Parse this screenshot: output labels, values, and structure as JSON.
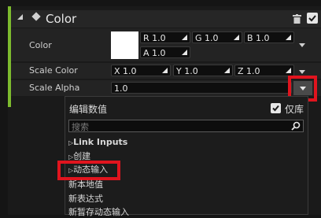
{
  "section": {
    "title": "Color"
  },
  "rows": {
    "color": {
      "label": "Color",
      "r": "R 1.0",
      "g": "G 1.0",
      "b": "B 1.0",
      "a": "A 1.0"
    },
    "scale_color": {
      "label": "Scale Color",
      "x": "X 1.0",
      "y": "Y 1.0",
      "z": "Z 1.0"
    },
    "scale_alpha": {
      "label": "Scale Alpha",
      "value": "1.0"
    }
  },
  "menu": {
    "title": "编辑数值",
    "library_label": "仅库",
    "search_placeholder": "搜索",
    "items": [
      {
        "label": "Link Inputs",
        "expander": "▷"
      },
      {
        "label": "创建",
        "expander": "▷"
      },
      {
        "label": "动态输入",
        "expander": "▷"
      },
      {
        "label": "新本地值"
      },
      {
        "label": "新表达式"
      },
      {
        "label": "新暂存动态输入"
      }
    ]
  },
  "colors": {
    "accent_green": "#7dbb2e",
    "highlight_red": "#e0141e",
    "swatch": "#ffffff"
  },
  "icons": [
    "collapse-triangle-icon",
    "stacked-square-icon",
    "trash-icon",
    "checkbox-checked-icon",
    "dropdown-chevron-icon",
    "search-icon"
  ]
}
